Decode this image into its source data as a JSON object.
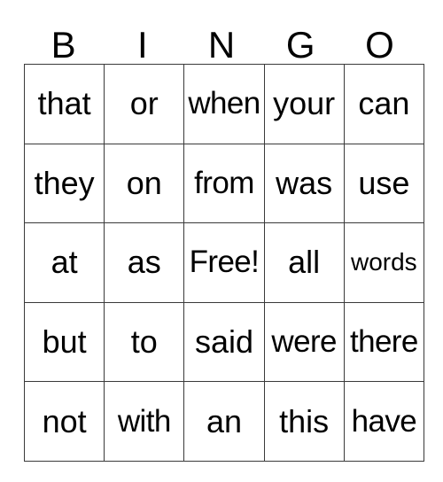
{
  "card": {
    "title": "BINGO",
    "headers": [
      "B",
      "I",
      "N",
      "G",
      "O"
    ],
    "free_space_label": "Free!",
    "colors": {
      "background": "#ffffff",
      "text": "#000000",
      "grid_line": "#3a3a3a",
      "grid_outer": "#111111"
    },
    "rows": [
      [
        {
          "text": "that",
          "size": "normal"
        },
        {
          "text": "or",
          "size": "normal"
        },
        {
          "text": "when",
          "size": "tight"
        },
        {
          "text": "your",
          "size": "normal"
        },
        {
          "text": "can",
          "size": "normal"
        }
      ],
      [
        {
          "text": "they",
          "size": "normal"
        },
        {
          "text": "on",
          "size": "normal"
        },
        {
          "text": "from",
          "size": "tight"
        },
        {
          "text": "was",
          "size": "normal"
        },
        {
          "text": "use",
          "size": "normal"
        }
      ],
      [
        {
          "text": "at",
          "size": "normal"
        },
        {
          "text": "as",
          "size": "normal"
        },
        {
          "text": "Free!",
          "size": "tight"
        },
        {
          "text": "all",
          "size": "normal"
        },
        {
          "text": "words",
          "size": "small"
        }
      ],
      [
        {
          "text": "but",
          "size": "normal"
        },
        {
          "text": "to",
          "size": "normal"
        },
        {
          "text": "said",
          "size": "normal"
        },
        {
          "text": "were",
          "size": "tight"
        },
        {
          "text": "there",
          "size": "tight"
        }
      ],
      [
        {
          "text": "not",
          "size": "normal"
        },
        {
          "text": "with",
          "size": "tight"
        },
        {
          "text": "an",
          "size": "normal"
        },
        {
          "text": "this",
          "size": "normal"
        },
        {
          "text": "have",
          "size": "tight"
        }
      ]
    ]
  }
}
